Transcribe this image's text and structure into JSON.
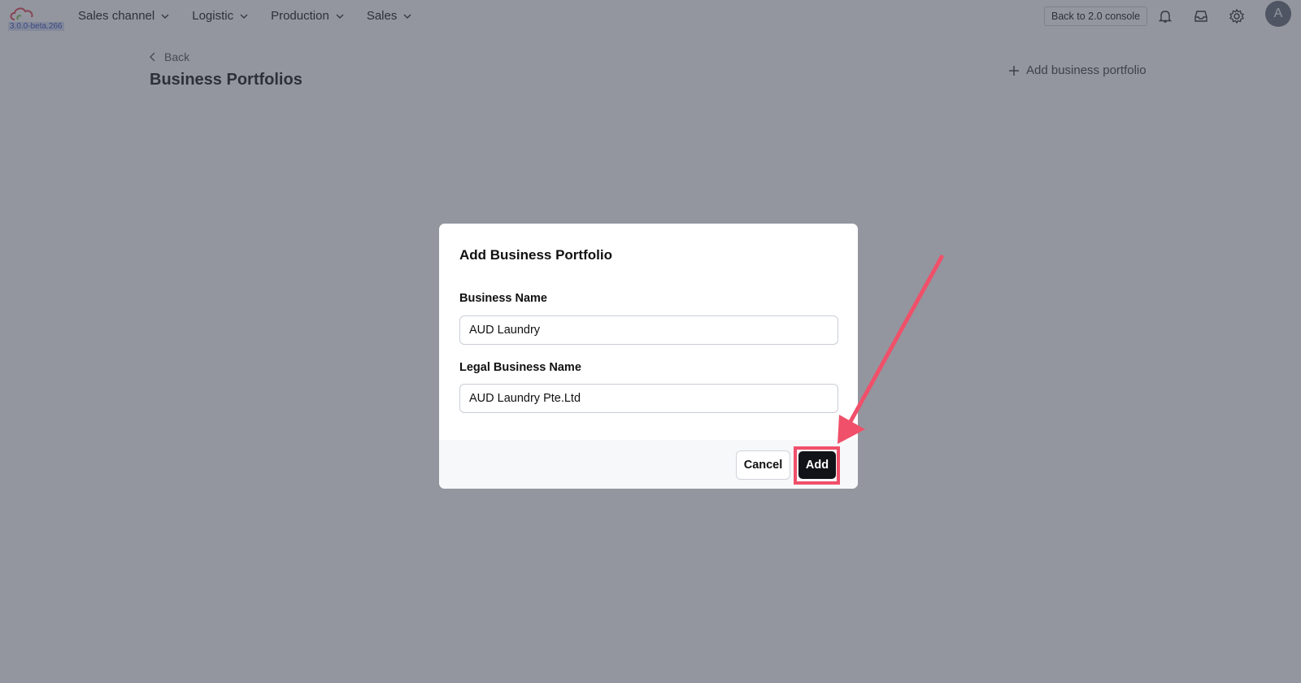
{
  "app": {
    "version": "3.0.0-beta.266"
  },
  "nav": {
    "items": [
      {
        "label": "Sales channel"
      },
      {
        "label": "Logistic"
      },
      {
        "label": "Production"
      },
      {
        "label": "Sales"
      }
    ]
  },
  "header": {
    "back_console_label": "Back to 2.0 console",
    "avatar_initial": "A"
  },
  "page": {
    "back_label": "Back",
    "title": "Business Portfolios",
    "add_label": "Add business portfolio"
  },
  "modal": {
    "title": "Add Business Portfolio",
    "business_name_label": "Business Name",
    "business_name_value": "AUD Laundry",
    "legal_name_label": "Legal Business Name",
    "legal_name_value": "AUD Laundry Pte.Ltd",
    "cancel_label": "Cancel",
    "add_label": "Add"
  },
  "annotation": {
    "color": "#f0506a"
  }
}
